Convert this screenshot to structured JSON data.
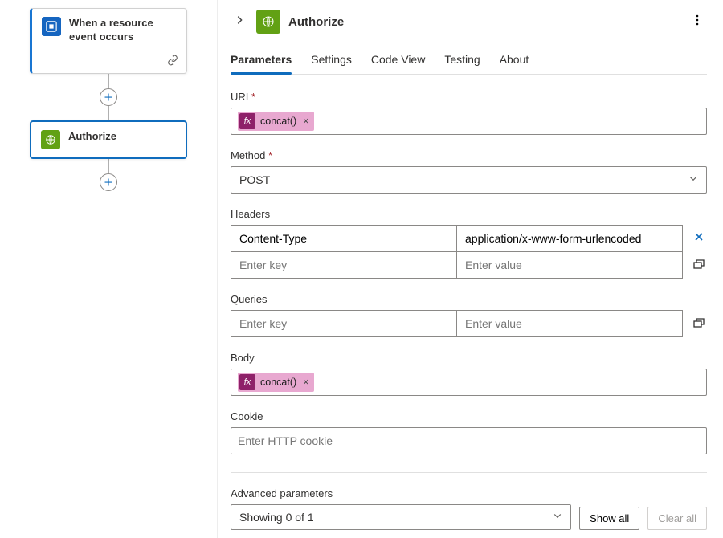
{
  "canvas": {
    "trigger": {
      "title": "When a resource event occurs"
    },
    "action": {
      "title": "Authorize"
    }
  },
  "panel": {
    "title": "Authorize",
    "tabs": [
      "Parameters",
      "Settings",
      "Code View",
      "Testing",
      "About"
    ],
    "activeTab": 0,
    "fields": {
      "uri_label": "URI",
      "uri_chip": "concat()",
      "method_label": "Method",
      "method_value": "POST",
      "headers_label": "Headers",
      "headers_rows": [
        {
          "key": "Content-Type",
          "value": "application/x-www-form-urlencoded"
        }
      ],
      "headers_key_placeholder": "Enter key",
      "headers_value_placeholder": "Enter value",
      "queries_label": "Queries",
      "queries_key_placeholder": "Enter key",
      "queries_value_placeholder": "Enter value",
      "body_label": "Body",
      "body_chip": "concat()",
      "cookie_label": "Cookie",
      "cookie_placeholder": "Enter HTTP cookie"
    },
    "advanced": {
      "label": "Advanced parameters",
      "select_text": "Showing 0 of 1",
      "show_all": "Show all",
      "clear_all": "Clear all"
    },
    "fx_glyph": "fx"
  }
}
